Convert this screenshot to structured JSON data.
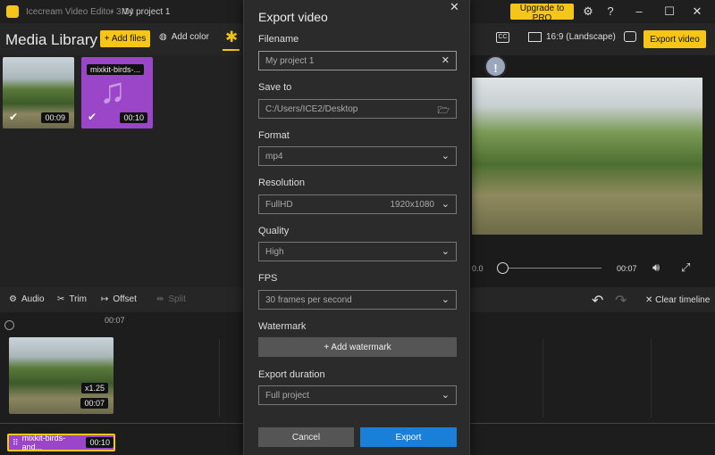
{
  "titlebar": {
    "app_title": "Icecream Video Editor 3.14",
    "separator": "-",
    "project": "My project 1",
    "upgrade": "Upgrade to PRO"
  },
  "toolbar": {
    "media_library": "Media Library",
    "add_files": "+ Add files",
    "add_color": "Add color",
    "aspect": "16:9 (Landscape)",
    "cc": "CC",
    "export": "Export video"
  },
  "media": {
    "items": [
      {
        "type": "video",
        "duration": "00:09"
      },
      {
        "type": "audio",
        "name": "mixkit-birds-...",
        "duration": "00:10"
      }
    ]
  },
  "edit_bar": {
    "audio": "Audio",
    "trim": "Trim",
    "offset": "Offset",
    "split": "Split",
    "clear": "Clear timeline"
  },
  "timeline": {
    "ruler_label": "00:07",
    "clip_speed": "x1.25",
    "clip_duration": "00:07",
    "audio_name": "mixkit-birds-and...",
    "audio_duration": "00:10"
  },
  "player": {
    "current": "0.0",
    "total": "00:07"
  },
  "dialog": {
    "title": "Export video",
    "filename_label": "Filename",
    "filename_placeholder": "My project 1",
    "save_to_label": "Save to",
    "save_to": "C:/Users/ICE2/Desktop",
    "format_label": "Format",
    "format": "mp4",
    "resolution_label": "Resolution",
    "resolution": "FullHD",
    "resolution_dims": "1920x1080",
    "quality_label": "Quality",
    "quality": "High",
    "fps_label": "FPS",
    "fps": "30 frames per second",
    "watermark_label": "Watermark",
    "watermark_button": "+ Add watermark",
    "duration_label": "Export duration",
    "duration": "Full project",
    "cancel": "Cancel",
    "export": "Export"
  }
}
